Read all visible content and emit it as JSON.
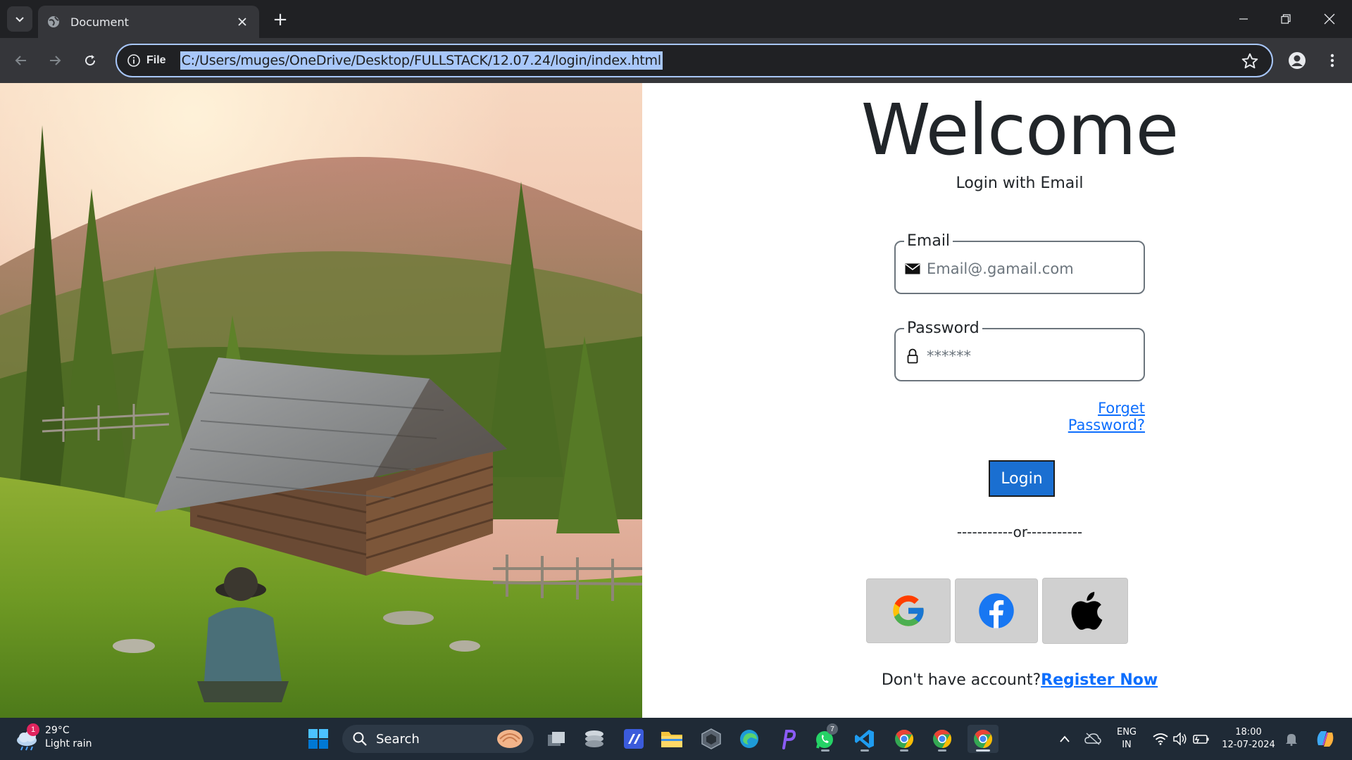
{
  "browser": {
    "tab_title": "Document",
    "new_tab_symbol": "+",
    "site_info_label": "File",
    "url": "C:/Users/muges/OneDrive/Desktop/FULLSTACK/12.07.24/login/index.html"
  },
  "page": {
    "heading": "Welcome",
    "subtitle": "Login with Email",
    "email": {
      "legend": "Email",
      "placeholder": "Email@.gamail.com",
      "value": ""
    },
    "password": {
      "legend": "Password",
      "placeholder": "******",
      "value": ""
    },
    "forget_link": "Forget Password?",
    "login_button": "Login",
    "separator": "-----------or-----------",
    "social_buttons": [
      "google-icon",
      "facebook-icon",
      "apple-icon"
    ],
    "register_prompt": "Don't have account?",
    "register_link": "Register Now",
    "colors": {
      "link": "#0d6efd",
      "login_button": "#1a6fd1",
      "social_bg": "#d0d0d0"
    }
  },
  "taskbar": {
    "weather_temp": "29°C",
    "weather_desc": "Light rain",
    "weather_badge": "1",
    "search_label": "Search",
    "whatsapp_badge": "7",
    "language_top": "ENG",
    "language_bottom": "IN",
    "time": "18:00",
    "date": "12-07-2024"
  }
}
